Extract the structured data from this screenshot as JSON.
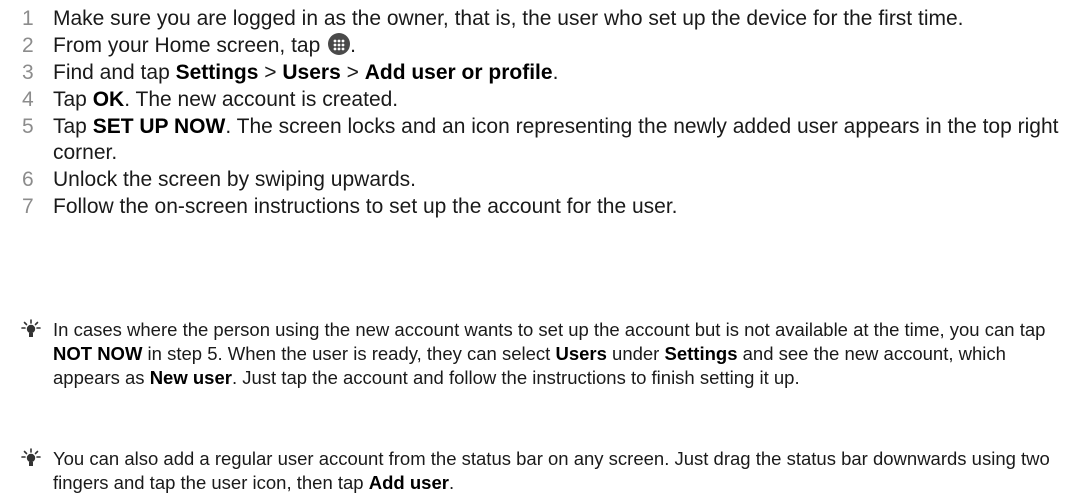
{
  "steps": [
    {
      "num": "1",
      "text": "Make sure you are logged in as the owner, that is, the user who set up the device for the first time."
    },
    {
      "num": "2",
      "pre": "From your Home screen, tap ",
      "icon": "apps-icon",
      "post": "."
    },
    {
      "num": "3",
      "pre": "Find and tap ",
      "b1": "Settings",
      "sep1": " > ",
      "b2": "Users",
      "sep2": " > ",
      "b3": "Add user or profile",
      "post": "."
    },
    {
      "num": "4",
      "pre": "Tap ",
      "b1": "OK",
      "post": ". The new account is created."
    },
    {
      "num": "5",
      "pre": "Tap ",
      "b1": "SET UP NOW",
      "post": ". The screen locks and an icon representing the newly added user appears in the top right corner."
    },
    {
      "num": "6",
      "text": "Unlock the screen by swiping upwards."
    },
    {
      "num": "7",
      "text": "Follow the on-screen instructions to set up the account for the user."
    }
  ],
  "tips": [
    {
      "icon": "lightbulb-tip-icon",
      "t1": "In cases where the person using the new account wants to set up the account but is not available at the time, you can tap ",
      "b1": "NOT NOW",
      "t2": " in step 5. When the user is ready, they can select ",
      "b2": "Users",
      "t3": " under ",
      "b3": "Settings",
      "t4": " and see the new account, which appears as ",
      "b4": "New user",
      "t5": ". Just tap the account and follow the instructions to finish setting it up."
    },
    {
      "icon": "lightbulb-tip-icon",
      "t1": "You can also add a regular user account from the status bar on any screen. Just drag the status bar downwards using two fingers and tap the user icon, then tap ",
      "b1": "Add user",
      "t2": "."
    }
  ]
}
